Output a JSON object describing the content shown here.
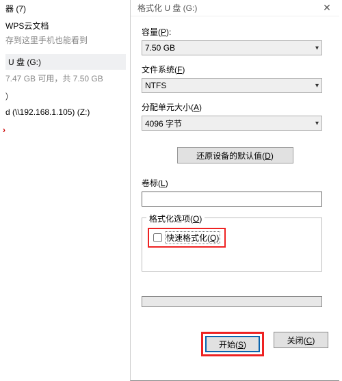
{
  "left": {
    "header": "器 (7)",
    "wps_title": "WPS云文档",
    "wps_sub": "存到这里手机也能看到",
    "udisk_title": "U 盘 (G:)",
    "udisk_sub": "7.47 GB 可用，共 7.50 GB",
    "paren": ")",
    "netdrive": "d (\\\\192.168.1.105) (Z:)"
  },
  "dialog": {
    "title": "格式化 U 盘 (G:)",
    "close": "✕",
    "capacity_label": "容量(",
    "capacity_key": "P",
    "capacity_label2": "):",
    "capacity_value": "7.50 GB",
    "fs_label": "文件系统(",
    "fs_key": "F",
    "fs_label2": ")",
    "fs_value": "NTFS",
    "alloc_label": "分配单元大小(",
    "alloc_key": "A",
    "alloc_label2": ")",
    "alloc_value": "4096 字节",
    "restore_label": "还原设备的默认值(",
    "restore_key": "D",
    "restore_label2": ")",
    "vol_label": "卷标(",
    "vol_key": "L",
    "vol_label2": ")",
    "vol_value": "",
    "options_label": "格式化选项(",
    "options_key": "O",
    "options_label2": ")",
    "quick_label": "快速格式化(",
    "quick_key": "Q",
    "quick_label2": ")",
    "start_label": "开始(",
    "start_key": "S",
    "start_label2": ")",
    "close_label": "关闭(",
    "close_key": "C",
    "close_label2": ")"
  }
}
